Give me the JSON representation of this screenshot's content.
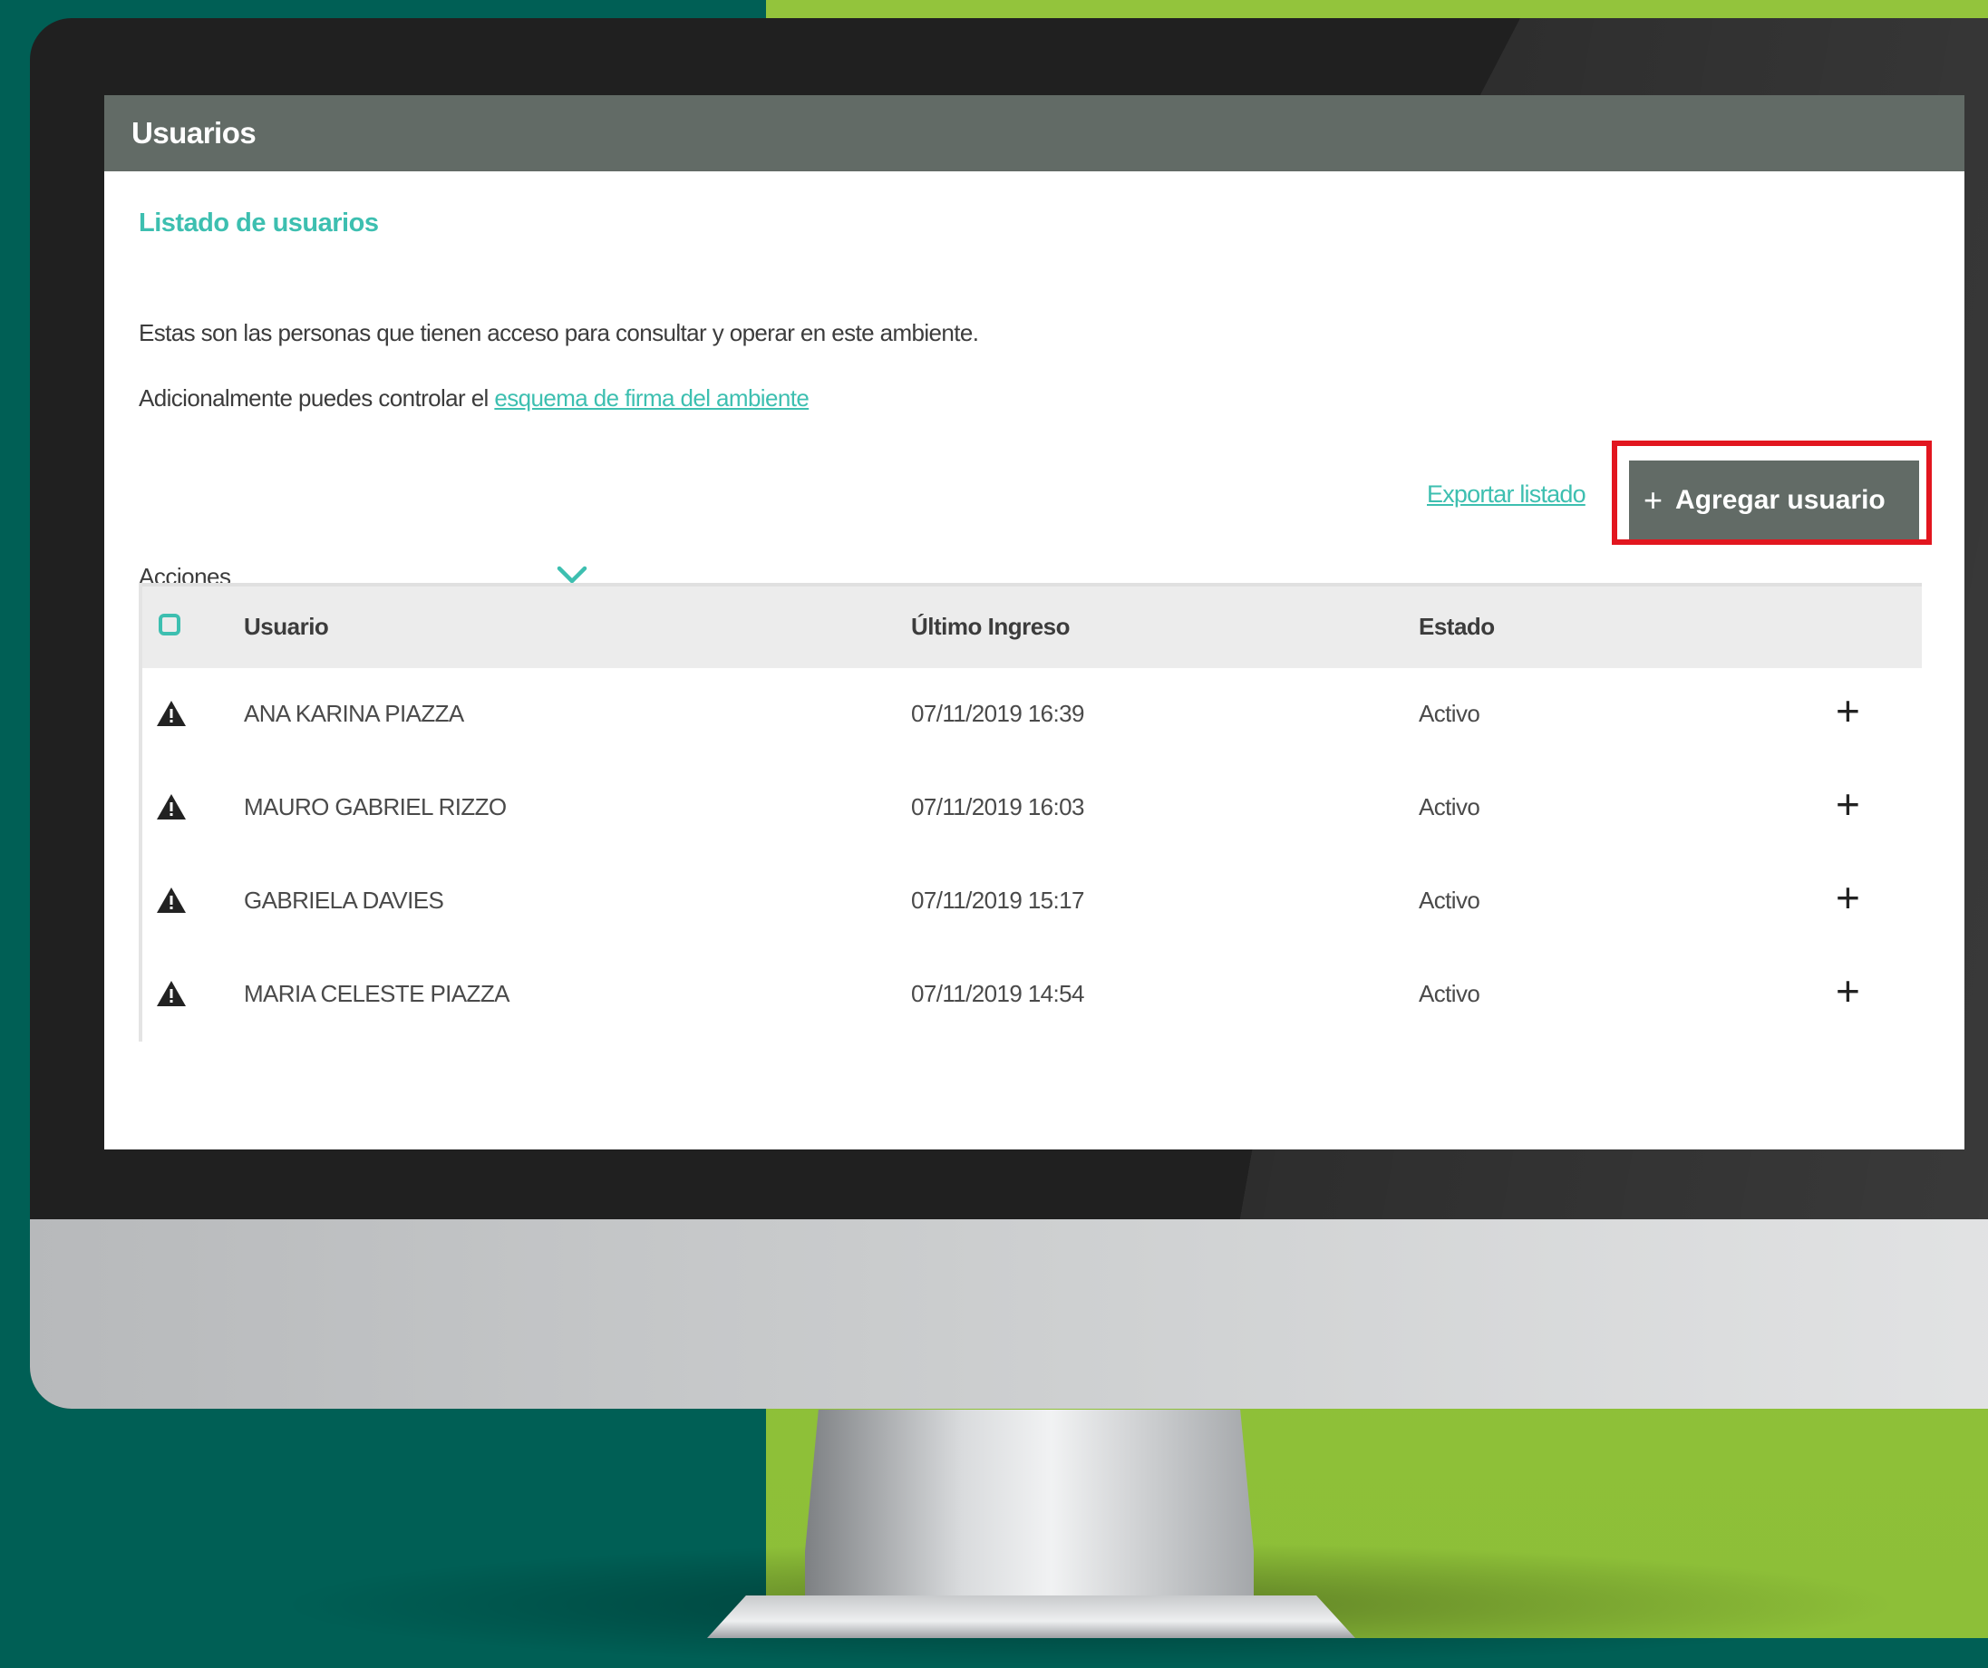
{
  "window": {
    "title": "Usuarios"
  },
  "section": {
    "title": "Listado de usuarios"
  },
  "description": {
    "line1": "Estas son las personas que tienen acceso para consultar y operar en este ambiente.",
    "line2_prefix": "Adicionalmente puedes controlar el ",
    "line2_link": "esquema de firma del ambiente"
  },
  "actions": {
    "label": "Acciones",
    "icon": "chevron-down-icon"
  },
  "toolbar": {
    "export_label": "Exportar listado",
    "add_label": "Agregar usuario",
    "add_icon": "plus-icon"
  },
  "table": {
    "columns": [
      "Usuario",
      "Último Ingreso",
      "Estado"
    ],
    "rows": [
      {
        "usuario": "ANA KARINA PIAZZA",
        "ultimo_ingreso": "07/11/2019 16:39",
        "estado": "Activo"
      },
      {
        "usuario": "MAURO GABRIEL RIZZO",
        "ultimo_ingreso": "07/11/2019 16:03",
        "estado": "Activo"
      },
      {
        "usuario": "GABRIELA DAVIES",
        "ultimo_ingreso": "07/11/2019 15:17",
        "estado": "Activo"
      },
      {
        "usuario": "MARIA CELESTE PIAZZA",
        "ultimo_ingreso": "07/11/2019 14:54",
        "estado": "Activo"
      }
    ],
    "row_icon": "warning-icon",
    "row_action_icon": "plus-icon"
  },
  "colors": {
    "accent": "#3dbfb0",
    "header_bar": "#626b66",
    "highlight": "#e2161f",
    "bg_left": "#005f55",
    "bg_right": "#93c43c"
  }
}
